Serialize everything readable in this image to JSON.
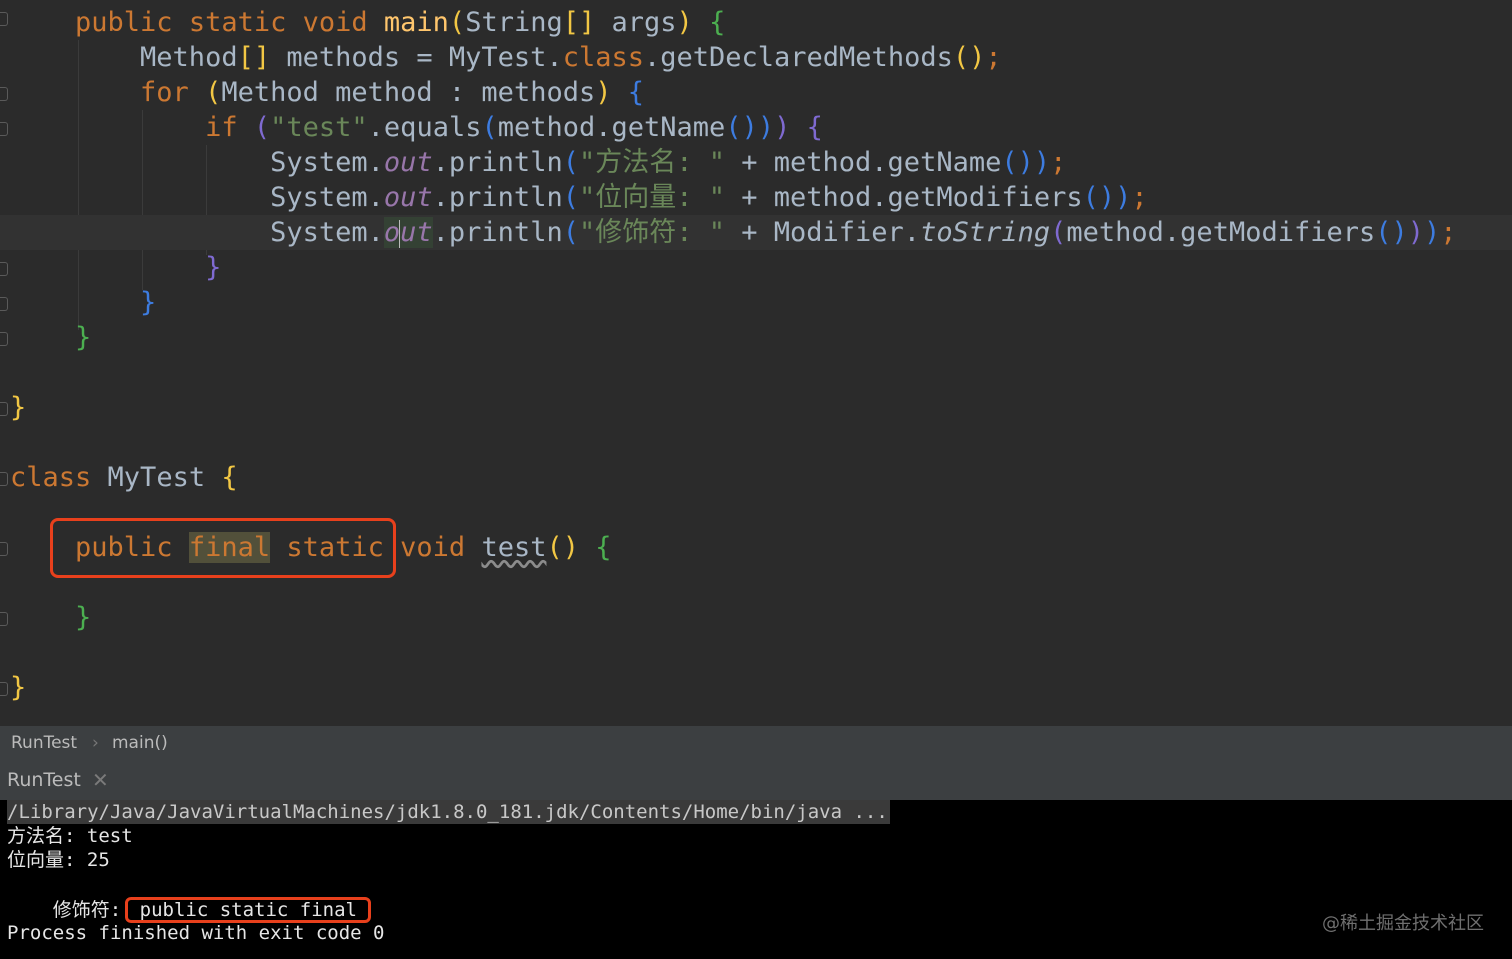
{
  "editor": {
    "lines": [
      [
        {
          "t": "    "
        },
        {
          "t": "public static void ",
          "c": "kw"
        },
        {
          "t": "main",
          "c": "fn"
        },
        {
          "t": "(",
          "c": "pY"
        },
        {
          "t": "String"
        },
        {
          "t": "[]",
          "c": "pY"
        },
        {
          "t": " args"
        },
        {
          "t": ")",
          "c": "pY"
        },
        {
          "t": " "
        },
        {
          "t": "{",
          "c": "pG"
        }
      ],
      [
        {
          "t": "        Method"
        },
        {
          "t": "[]",
          "c": "pY"
        },
        {
          "t": " methods = MyTest."
        },
        {
          "t": "class",
          "c": "kw"
        },
        {
          "t": ".getDeclaredMethods"
        },
        {
          "t": "()",
          "c": "pY"
        },
        {
          "t": ";",
          "c": "kw"
        }
      ],
      [
        {
          "t": "        "
        },
        {
          "t": "for ",
          "c": "kw"
        },
        {
          "t": "(",
          "c": "pY"
        },
        {
          "t": "Method method : methods"
        },
        {
          "t": ")",
          "c": "pY"
        },
        {
          "t": " "
        },
        {
          "t": "{",
          "c": "pB"
        }
      ],
      [
        {
          "t": "            "
        },
        {
          "t": "if ",
          "c": "kw"
        },
        {
          "t": "(",
          "c": "pP"
        },
        {
          "t": "\"test\"",
          "c": "str"
        },
        {
          "t": ".equals"
        },
        {
          "t": "(",
          "c": "pB"
        },
        {
          "t": "method.getName"
        },
        {
          "t": "()",
          "c": "pB"
        },
        {
          "t": ")",
          "c": "pB"
        },
        {
          "t": ")",
          "c": "pP"
        },
        {
          "t": " "
        },
        {
          "t": "{",
          "c": "pP"
        }
      ],
      [
        {
          "t": "                System."
        },
        {
          "t": "out",
          "c": "field"
        },
        {
          "t": ".println"
        },
        {
          "t": "(",
          "c": "pB"
        },
        {
          "t": "\"方法名: \"",
          "c": "str"
        },
        {
          "t": " + method.getName"
        },
        {
          "t": "()",
          "c": "pB"
        },
        {
          "t": ")",
          "c": "pB"
        },
        {
          "t": ";",
          "c": "kw"
        }
      ],
      [
        {
          "t": "                System."
        },
        {
          "t": "out",
          "c": "field"
        },
        {
          "t": ".println"
        },
        {
          "t": "(",
          "c": "pB"
        },
        {
          "t": "\"位向量: \"",
          "c": "str"
        },
        {
          "t": " + method.getModifiers"
        },
        {
          "t": "()",
          "c": "pB"
        },
        {
          "t": ")",
          "c": "pB"
        },
        {
          "t": ";",
          "c": "kw"
        }
      ],
      [
        {
          "t": "                System."
        },
        {
          "t": "o",
          "c": "field out-hl"
        },
        {
          "caret": true
        },
        {
          "t": "ut",
          "c": "field out-hl"
        },
        {
          "t": ".println"
        },
        {
          "t": "(",
          "c": "pB"
        },
        {
          "t": "\"修饰符: \"",
          "c": "str"
        },
        {
          "t": " + Modifier."
        },
        {
          "t": "toString",
          "c": "static-call"
        },
        {
          "t": "(",
          "c": "pP"
        },
        {
          "t": "method.getModifiers"
        },
        {
          "t": "()",
          "c": "pB"
        },
        {
          "t": ")",
          "c": "pP"
        },
        {
          "t": ")",
          "c": "pB"
        },
        {
          "t": ";",
          "c": "kw"
        }
      ],
      [
        {
          "t": "            "
        },
        {
          "t": "}",
          "c": "pP"
        }
      ],
      [
        {
          "t": "        "
        },
        {
          "t": "}",
          "c": "pB"
        }
      ],
      [
        {
          "t": "    "
        },
        {
          "t": "}",
          "c": "pG"
        }
      ],
      [],
      [
        {
          "t": "}",
          "c": "pY"
        }
      ],
      [],
      [
        {
          "t": "class ",
          "c": "kw"
        },
        {
          "t": "MyTest "
        },
        {
          "t": "{",
          "c": "pY"
        }
      ],
      [],
      [
        {
          "t": "    "
        },
        {
          "t": "public ",
          "c": "kw"
        },
        {
          "t": "final",
          "c": "kw hl-final"
        },
        {
          "t": " static ",
          "c": "kw"
        },
        {
          "t": "void ",
          "c": "kw"
        },
        {
          "t": "test",
          "c": "squiggle"
        },
        {
          "t": "()",
          "c": "pY"
        },
        {
          "t": " "
        },
        {
          "t": "{",
          "c": "pG"
        }
      ],
      [],
      [
        {
          "t": "    "
        },
        {
          "t": "}",
          "c": "pG"
        }
      ],
      [],
      [
        {
          "t": "}",
          "c": "pY"
        }
      ]
    ]
  },
  "breadcrumb": {
    "class_name": "RunTest",
    "separator": "›",
    "method_name": "main()"
  },
  "run_panel": {
    "tab_label": "RunTest",
    "close_glyph": "✕"
  },
  "console": {
    "command": "/Library/Java/JavaVirtualMachines/jdk1.8.0_181.jdk/Contents/Home/bin/java ...",
    "line1": "方法名: test",
    "line2": "位向量: 25",
    "line3_label": "修饰符:",
    "line3_value": " public static final ",
    "exit": "Process finished with exit code 0"
  },
  "watermark": "@稀土掘金技术社区",
  "colors": {
    "editor_bg": "#2b2b2b",
    "keyword": "#cc7832",
    "method_decl": "#ffc66d",
    "string": "#6a8759",
    "static_field": "#9876aa",
    "annotation_box": "#e8401c",
    "console_bg": "#000000"
  }
}
